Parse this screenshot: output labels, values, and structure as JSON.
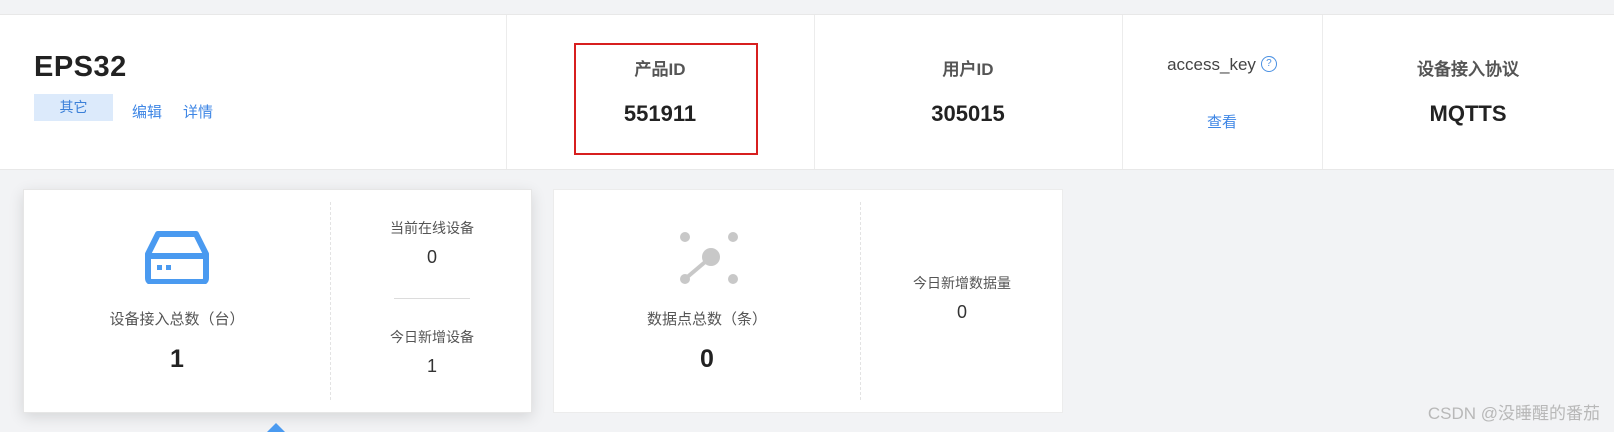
{
  "product": {
    "name": "EPS32",
    "category": "其它",
    "edit_label": "编辑",
    "detail_label": "详情"
  },
  "fields": {
    "product_id": {
      "label": "产品ID",
      "value": "551911"
    },
    "user_id": {
      "label": "用户ID",
      "value": "305015"
    },
    "access_key": {
      "label": "access_key",
      "action": "查看",
      "help_icon": "?"
    },
    "protocol": {
      "label": "设备接入协议",
      "value": "MQTTS"
    }
  },
  "device_stats": {
    "total_label": "设备接入总数（台）",
    "total_value": "1",
    "online_label": "当前在线设备",
    "online_value": "0",
    "new_today_label": "今日新增设备",
    "new_today_value": "1",
    "icon": "device-server-icon"
  },
  "data_stats": {
    "total_label": "数据点总数（条）",
    "total_value": "0",
    "new_today_label": "今日新增数据量",
    "new_today_value": "0",
    "icon": "data-points-icon"
  },
  "watermark": "CSDN @没睡醒的番茄",
  "colors": {
    "accent": "#3e86e5",
    "highlight": "#d71f1f",
    "icon_blue": "#4a9af0",
    "icon_gray": "#c8c8c8"
  }
}
